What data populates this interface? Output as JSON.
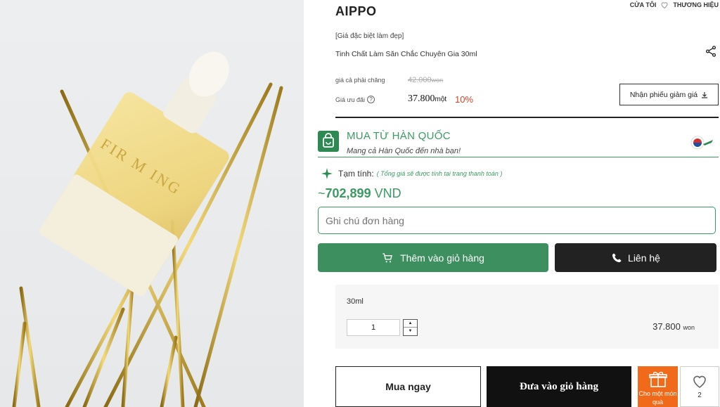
{
  "header": {
    "brand": "AIPPO",
    "my_store": "CỬA TÔI",
    "brand_link": "THƯƠNG HIỆU"
  },
  "product": {
    "tag": "[Giá đặc biệt làm đẹp]",
    "name": "Tinh Chất Làm Săn Chắc Chuyên Gia 30ml",
    "bottle_text": "FIR M ING",
    "price_label": "giá cả phải chăng",
    "old_price": "42.000",
    "old_unit": "won",
    "sale_label": "Giá ưu đãi",
    "help_mark": "?",
    "sale_price": "37.800",
    "sale_unit": "một",
    "discount": "10%",
    "coupon_label": "Nhận phiếu giảm giá"
  },
  "korea": {
    "title": "MUA TỪ HÀN QUỐC",
    "subtitle": "Mang cả Hàn Quốc đến nhà bạn!",
    "estimate_label": "Tạm tính:",
    "estimate_note": "( Tổng giá sẽ được tính tại trang thanh toán )",
    "total_prefix": "~",
    "total_value": "702,899",
    "total_currency": "VND",
    "note_placeholder": "Ghi chú đơn hàng",
    "add_cart": "Thêm vào giỏ hàng",
    "contact": "Liên hệ"
  },
  "option": {
    "name": "30ml",
    "quantity": "1",
    "price": "37.800",
    "unit": "won"
  },
  "actions": {
    "buy_now": "Mua ngay",
    "add_to_cart": "Đưa vào giỏ hàng",
    "gift": "Cho một món quà",
    "wish_count": "2"
  },
  "colors": {
    "green": "#3a9a61",
    "discount_red": "#e0402a",
    "gift_orange": "#f06a1a"
  }
}
